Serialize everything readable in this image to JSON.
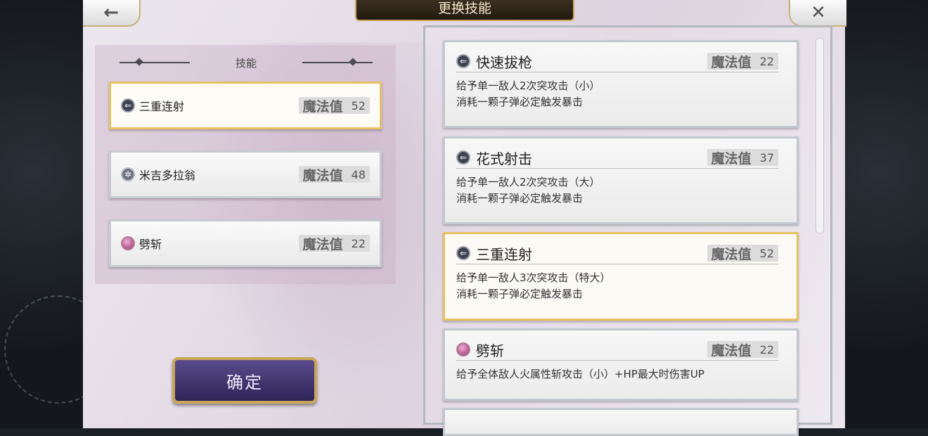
{
  "title": "更换技能",
  "back_icon": "←",
  "close_icon": "✕",
  "left_panel": {
    "header": "技能",
    "equipped": [
      {
        "icon": "gun-icon",
        "name": "三重连射",
        "mp_label": "魔法值",
        "mp": "52",
        "selected": true
      },
      {
        "icon": "star-icon",
        "name": "米吉多拉翁",
        "mp_label": "魔法值",
        "mp": "48",
        "selected": false
      },
      {
        "icon": "slash-icon",
        "name": "劈斩",
        "mp_label": "魔法值",
        "mp": "22",
        "selected": false
      }
    ]
  },
  "confirm_label": "确定",
  "skill_list": [
    {
      "icon": "gun-icon",
      "name": "快速拔枪",
      "mp_label": "魔法值",
      "mp": "22",
      "lines": [
        "给予单一敌人2次突攻击（小）",
        "消耗一颗子弹必定触发暴击"
      ],
      "selected": false
    },
    {
      "icon": "gun-icon",
      "name": "花式射击",
      "mp_label": "魔法值",
      "mp": "37",
      "lines": [
        "给予单一敌人2次突攻击（大）",
        "消耗一颗子弹必定触发暴击"
      ],
      "selected": false
    },
    {
      "icon": "gun-icon",
      "name": "三重连射",
      "mp_label": "魔法值",
      "mp": "52",
      "lines": [
        "给予单一敌人3次突攻击（特大）",
        "消耗一颗子弹必定触发暴击"
      ],
      "selected": true
    },
    {
      "icon": "slash-icon",
      "name": "劈斩",
      "mp_label": "魔法值",
      "mp": "22",
      "lines": [
        "给予全体敌人火属性斩攻击（小）+HP最大时伤害UP"
      ],
      "selected": false
    }
  ],
  "colors": {
    "selected_border": "#e8c164",
    "frame_gold": "#c9a65a",
    "confirm_button": "#3f336e"
  }
}
